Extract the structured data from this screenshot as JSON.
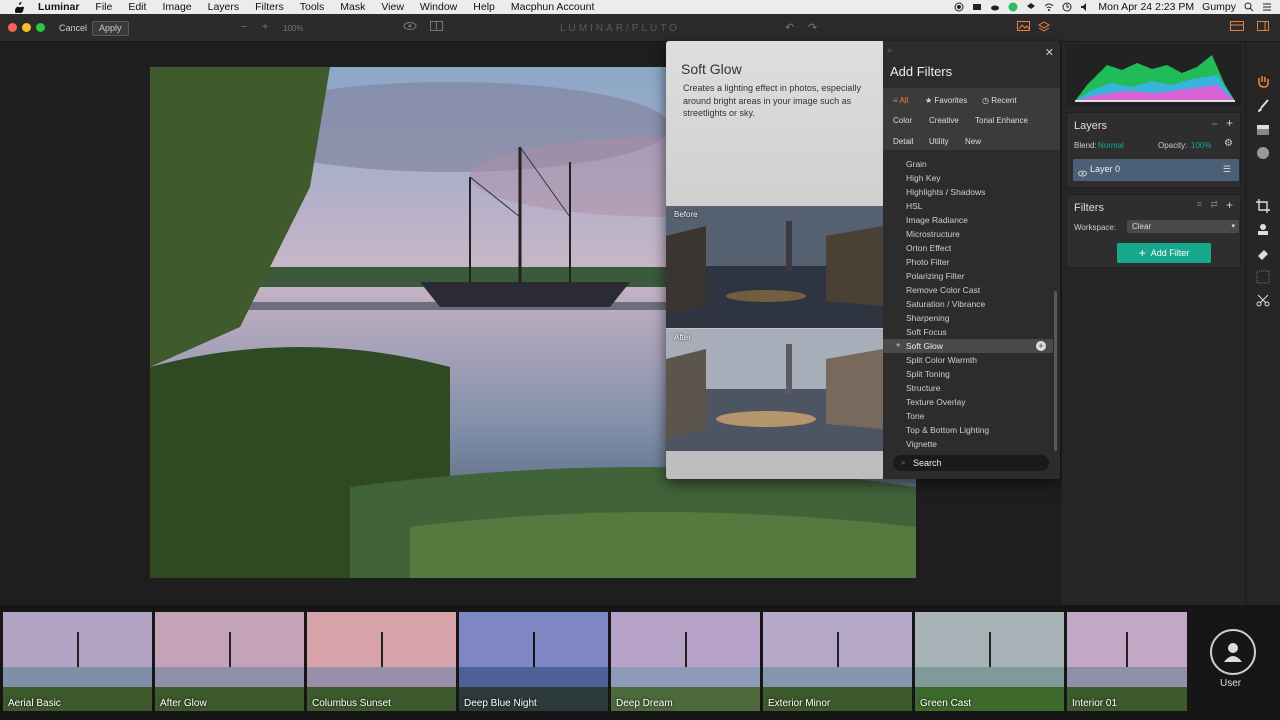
{
  "menubar": {
    "app": "Luminar",
    "items": [
      "File",
      "Edit",
      "Image",
      "Layers",
      "Filters",
      "Tools",
      "Mask",
      "View",
      "Window",
      "Help",
      "Macphun Account"
    ],
    "clock": "Mon Apr 24  2:23 PM",
    "user": "Gumpy"
  },
  "toolbar": {
    "cancel": "Cancel",
    "apply": "Apply",
    "zoom": "100%",
    "brand": "LUMINAR/PLUTO"
  },
  "popup": {
    "preview_title": "Soft Glow",
    "preview_desc": "Creates a lighting effect in photos, especially around bright areas in your image such as streetlights or sky.",
    "before_label": "Before",
    "after_label": "After",
    "title": "Add Filters",
    "categories_row1": [
      "All",
      "Favorites",
      "Recent"
    ],
    "categories_row2": [
      "Color",
      "Creative",
      "Tonal Enhance"
    ],
    "categories_row3": [
      "Detail",
      "Utility",
      "New"
    ],
    "filters": [
      "Grain",
      "High Key",
      "Highlights / Shadows",
      "HSL",
      "Image Radiance",
      "Microstructure",
      "Orton Effect",
      "Photo Filter",
      "Polarizing Filter",
      "Remove Color Cast",
      "Saturation / Vibrance",
      "Sharpening",
      "Soft Focus",
      "Soft Glow",
      "Split Color Warmth",
      "Split Toning",
      "Structure",
      "Texture Overlay",
      "Tone",
      "Top & Bottom Lighting",
      "Vignette"
    ],
    "highlighted": "Soft Glow",
    "search_value": "Search"
  },
  "right_panel": {
    "layers_title": "Layers",
    "blend_label": "Blend:",
    "blend_value": "Normal",
    "opacity_label": "Opacity:",
    "opacity_value": "100%",
    "layer_name": "Layer 0",
    "filters_title": "Filters",
    "workspace_label": "Workspace:",
    "workspace_value": "Clear",
    "add_filter": "Add Filter"
  },
  "filmstrip": {
    "presets": [
      "Aerial Basic",
      "After Glow",
      "Columbus Sunset",
      "Deep Blue Night",
      "Deep Dream",
      "Exterior Minor",
      "Green Cast",
      "Interior 01"
    ],
    "user_label": "User"
  },
  "colors": {
    "accent": "#18a98c",
    "active_category": "#e8823a",
    "layer_row": "#4b5f76"
  }
}
